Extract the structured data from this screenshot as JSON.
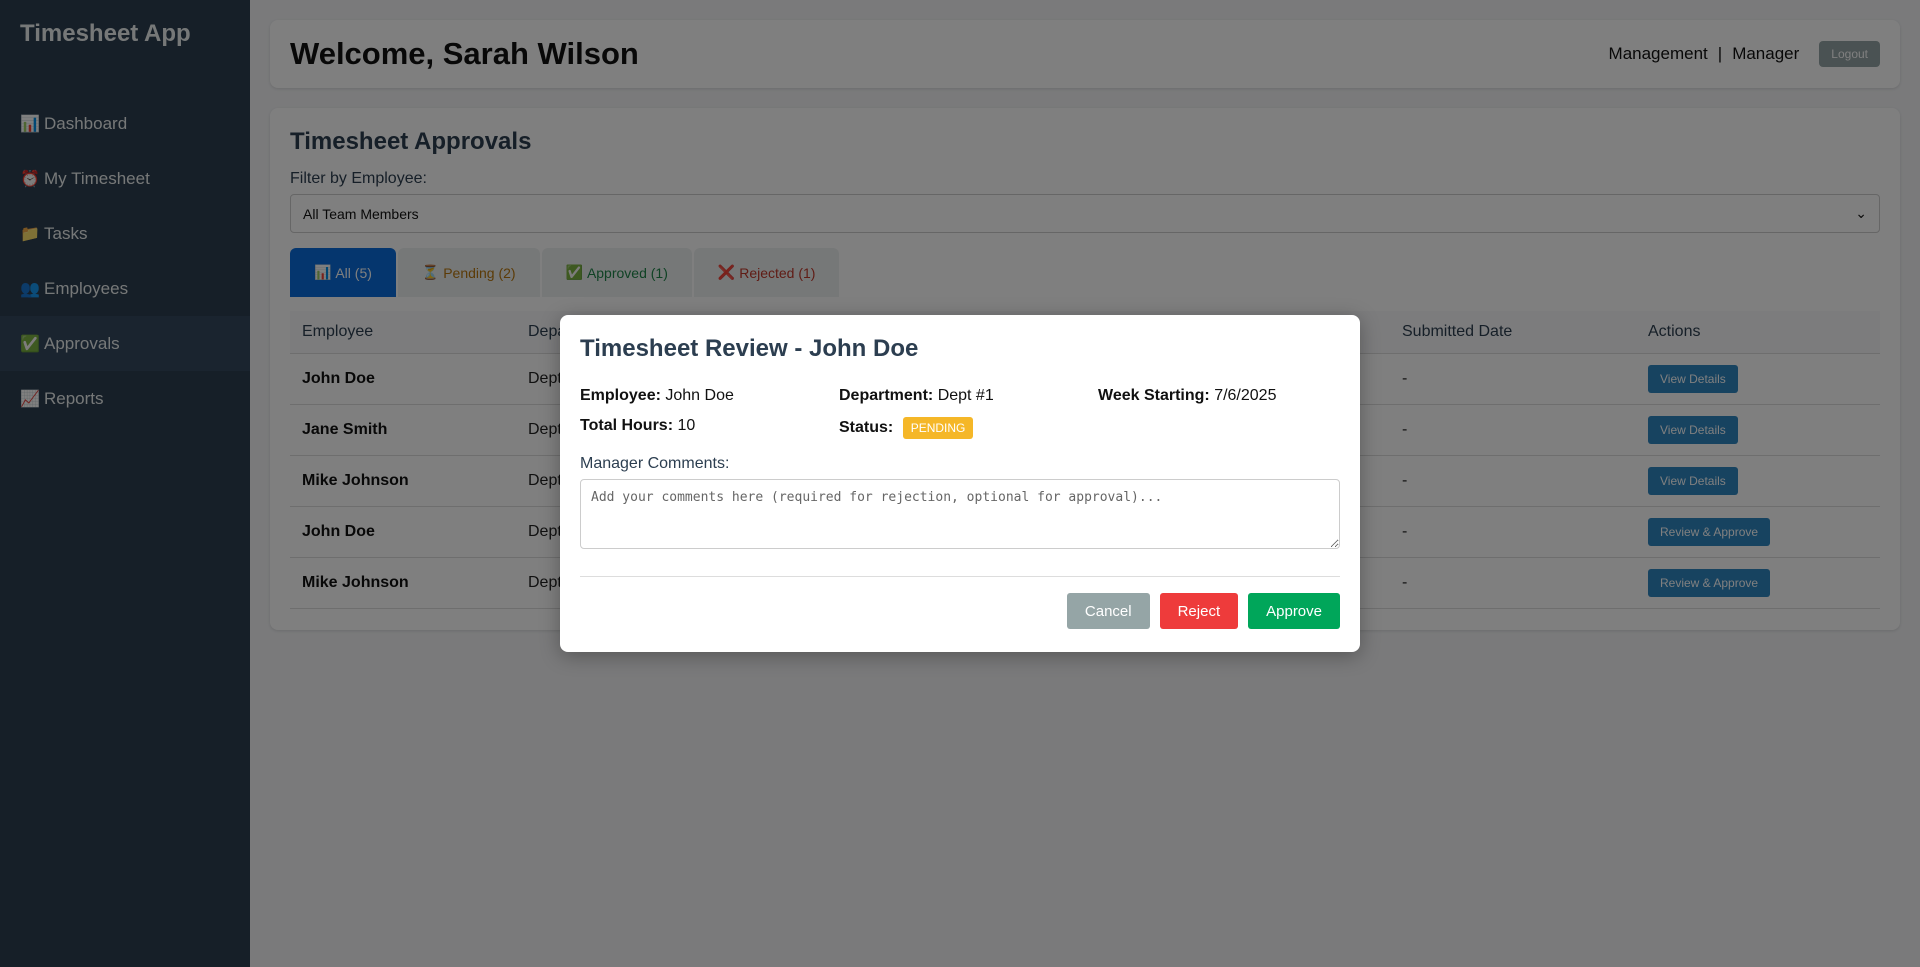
{
  "app": {
    "title": "Timesheet App"
  },
  "sidebar": {
    "items": [
      {
        "icon": "📊",
        "label": "Dashboard"
      },
      {
        "icon": "⏰",
        "label": "My Timesheet"
      },
      {
        "icon": "📁",
        "label": "Tasks"
      },
      {
        "icon": "👥",
        "label": "Employees"
      },
      {
        "icon": "✅",
        "label": "Approvals",
        "active": true
      },
      {
        "icon": "📈",
        "label": "Reports"
      }
    ]
  },
  "header": {
    "welcome": "Welcome, Sarah Wilson",
    "department": "Management",
    "separator": "|",
    "role": "Manager",
    "logout_label": "Logout"
  },
  "approvals": {
    "title": "Timesheet Approvals",
    "filter_label": "Filter by Employee:",
    "filter_value": "All Team Members",
    "tabs": [
      {
        "icon": "📊",
        "label": "All (5)"
      },
      {
        "icon": "⏳",
        "label": "Pending (2)"
      },
      {
        "icon": "✅",
        "label": "Approved (1)"
      },
      {
        "icon": "❌",
        "label": "Rejected (1)"
      }
    ],
    "columns": [
      "Employee",
      "Depa",
      "Submitted Date",
      "Actions"
    ],
    "rows": [
      {
        "employee": "John Doe",
        "dept": "Dept",
        "submitted": "-",
        "action": "View Details"
      },
      {
        "employee": "Jane Smith",
        "dept": "Dept",
        "submitted": "-",
        "action": "View Details"
      },
      {
        "employee": "Mike Johnson",
        "dept": "Dept",
        "submitted": "-",
        "action": "View Details"
      },
      {
        "employee": "John Doe",
        "dept": "Dept",
        "submitted": "-",
        "action": "Review & Approve"
      },
      {
        "employee": "Mike Johnson",
        "dept": "Dept",
        "submitted": "-",
        "action": "Review & Approve"
      }
    ]
  },
  "modal": {
    "title": "Timesheet Review - John Doe",
    "employee_label": "Employee:",
    "employee_value": "John Doe",
    "department_label": "Department:",
    "department_value": "Dept #1",
    "week_label": "Week Starting:",
    "week_value": "7/6/2025",
    "hours_label": "Total Hours:",
    "hours_value": "10",
    "status_label": "Status:",
    "status_value": "PENDING",
    "comments_label": "Manager Comments:",
    "comments_placeholder": "Add your comments here (required for rejection, optional for approval)...",
    "cancel_label": "Cancel",
    "reject_label": "Reject",
    "approve_label": "Approve"
  },
  "colors": {
    "sidebar_bg": "#2c3e50",
    "active_tab": "#0a6cdc",
    "status_pending": "#f5b728",
    "reject": "#ee3b3b",
    "approve": "#00a65a",
    "cancel": "#95a5a6"
  }
}
